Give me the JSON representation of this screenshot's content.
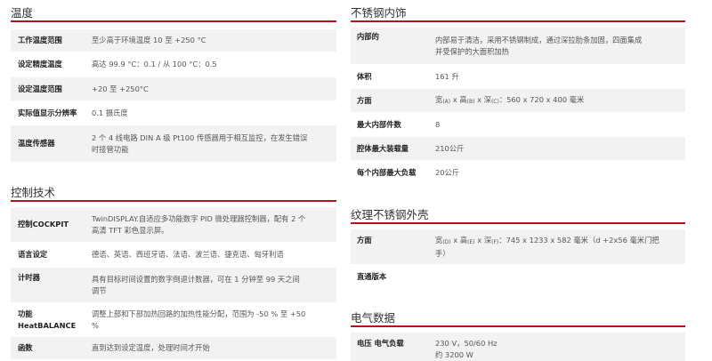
{
  "left": {
    "temperature": {
      "title": "温度",
      "rows": [
        {
          "label": "工作温度范围",
          "value": "至少高于环境温度 10 至 +250 °C"
        },
        {
          "label": "设定精度温度",
          "value": "高达 99.9 °C：0.1 / 从 100 °C：0.5"
        },
        {
          "label": "设定温度范围",
          "value": "+20 至 +250°C"
        },
        {
          "label": "实际值显示分辨率",
          "value": "0.1 摄氏度"
        },
        {
          "label": "温度传感器",
          "value_lines": [
            "2 个 4 线电路 DIN A 级 Pt100 传感器用于相互监控，在发生错误",
            "时接管功能"
          ]
        }
      ]
    },
    "control": {
      "title": "控制技术",
      "rows": [
        {
          "label": "控制COCKPIT",
          "value_lines": [
            "TwinDISPLAY.自适应多功能数字 PID 微处理器控制器，配有 2 个",
            "高清 TFT 彩色显示屏。"
          ]
        },
        {
          "label": "语言设定",
          "value": "德语、英语、西班牙语、法语、波兰语、捷克语、匈牙利语"
        },
        {
          "label": "计时器",
          "value_lines": [
            "具有目标时间设置的数字倒退计数器，可在 1 分钟至 99 天之间",
            "调节"
          ]
        },
        {
          "label_lines": [
            "功能",
            "HeatBALANCE"
          ],
          "value_lines": [
            "调整上部和下部加热回路的加热性能分配，范围为 -50 % 至 +50",
            "%"
          ]
        },
        {
          "label": "函数",
          "value": "直到达到设定温度，处理时间才开始"
        }
      ]
    }
  },
  "right": {
    "interior": {
      "title": "不锈钢内饰",
      "rows": [
        {
          "label": "内部的",
          "value_lines": [
            "内部易于清洁，采用不锈钢制成，通过深拉肋条加固，四面集成",
            "并受保护的大面积加热"
          ]
        },
        {
          "label": "体积",
          "value": "161 升"
        },
        {
          "label": "方面",
          "dim": {
            "w": "宽",
            "w_sub": "(A)",
            "h": "高",
            "h_sub": "(B)",
            "d": "深",
            "d_sub": "(C)",
            "rest": "：560 x 720 x 400 毫米"
          }
        },
        {
          "label": "最大内部件数",
          "value": "8"
        },
        {
          "label": "腔体最大装载量",
          "value": "210公斤"
        },
        {
          "label": "每个内部最大负载",
          "value": "20公斤"
        }
      ]
    },
    "housing": {
      "title": "纹理不锈钢外壳",
      "rows": [
        {
          "label": "方面",
          "dim": {
            "w": "宽",
            "w_sub": "(D)",
            "h": "高",
            "h_sub": "(E)",
            "d": "深",
            "d_sub": "(F)",
            "rest": "：745 x 1233 x 582 毫米（d +2x56 毫米门把"
          },
          "value2": "手）"
        },
        {
          "label": "直通版本",
          "value": ""
        }
      ]
    },
    "electric": {
      "title": "电气数据",
      "rows": [
        {
          "label": "电压 电气负载",
          "value": "230 V，50/60 Hz",
          "value2": "约 3200 W"
        }
      ]
    }
  }
}
